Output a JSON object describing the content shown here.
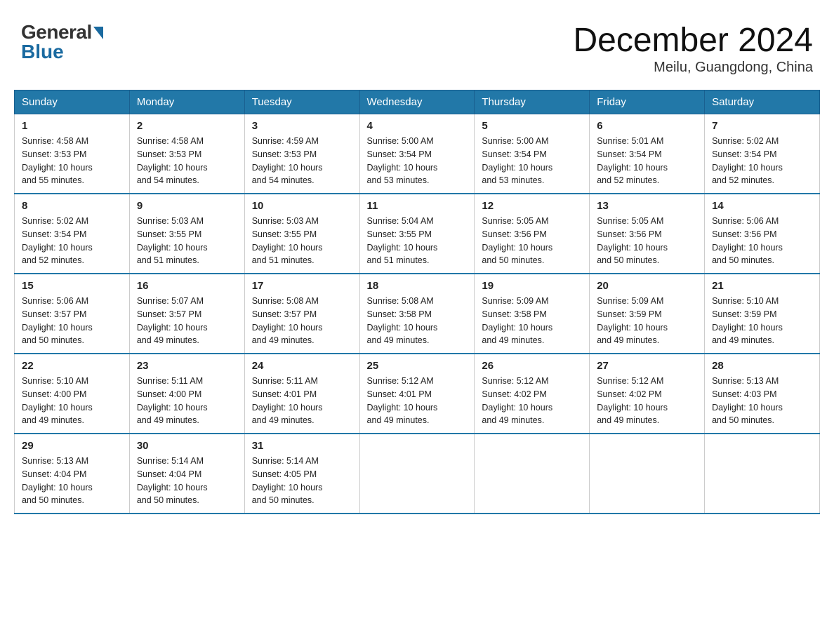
{
  "header": {
    "logo_general": "General",
    "logo_blue": "Blue",
    "month_title": "December 2024",
    "location": "Meilu, Guangdong, China"
  },
  "weekdays": [
    "Sunday",
    "Monday",
    "Tuesday",
    "Wednesday",
    "Thursday",
    "Friday",
    "Saturday"
  ],
  "weeks": [
    [
      {
        "day": "1",
        "sunrise": "4:58 AM",
        "sunset": "3:53 PM",
        "daylight": "10 hours and 55 minutes."
      },
      {
        "day": "2",
        "sunrise": "4:58 AM",
        "sunset": "3:53 PM",
        "daylight": "10 hours and 54 minutes."
      },
      {
        "day": "3",
        "sunrise": "4:59 AM",
        "sunset": "3:53 PM",
        "daylight": "10 hours and 54 minutes."
      },
      {
        "day": "4",
        "sunrise": "5:00 AM",
        "sunset": "3:54 PM",
        "daylight": "10 hours and 53 minutes."
      },
      {
        "day": "5",
        "sunrise": "5:00 AM",
        "sunset": "3:54 PM",
        "daylight": "10 hours and 53 minutes."
      },
      {
        "day": "6",
        "sunrise": "5:01 AM",
        "sunset": "3:54 PM",
        "daylight": "10 hours and 52 minutes."
      },
      {
        "day": "7",
        "sunrise": "5:02 AM",
        "sunset": "3:54 PM",
        "daylight": "10 hours and 52 minutes."
      }
    ],
    [
      {
        "day": "8",
        "sunrise": "5:02 AM",
        "sunset": "3:54 PM",
        "daylight": "10 hours and 52 minutes."
      },
      {
        "day": "9",
        "sunrise": "5:03 AM",
        "sunset": "3:55 PM",
        "daylight": "10 hours and 51 minutes."
      },
      {
        "day": "10",
        "sunrise": "5:03 AM",
        "sunset": "3:55 PM",
        "daylight": "10 hours and 51 minutes."
      },
      {
        "day": "11",
        "sunrise": "5:04 AM",
        "sunset": "3:55 PM",
        "daylight": "10 hours and 51 minutes."
      },
      {
        "day": "12",
        "sunrise": "5:05 AM",
        "sunset": "3:56 PM",
        "daylight": "10 hours and 50 minutes."
      },
      {
        "day": "13",
        "sunrise": "5:05 AM",
        "sunset": "3:56 PM",
        "daylight": "10 hours and 50 minutes."
      },
      {
        "day": "14",
        "sunrise": "5:06 AM",
        "sunset": "3:56 PM",
        "daylight": "10 hours and 50 minutes."
      }
    ],
    [
      {
        "day": "15",
        "sunrise": "5:06 AM",
        "sunset": "3:57 PM",
        "daylight": "10 hours and 50 minutes."
      },
      {
        "day": "16",
        "sunrise": "5:07 AM",
        "sunset": "3:57 PM",
        "daylight": "10 hours and 49 minutes."
      },
      {
        "day": "17",
        "sunrise": "5:08 AM",
        "sunset": "3:57 PM",
        "daylight": "10 hours and 49 minutes."
      },
      {
        "day": "18",
        "sunrise": "5:08 AM",
        "sunset": "3:58 PM",
        "daylight": "10 hours and 49 minutes."
      },
      {
        "day": "19",
        "sunrise": "5:09 AM",
        "sunset": "3:58 PM",
        "daylight": "10 hours and 49 minutes."
      },
      {
        "day": "20",
        "sunrise": "5:09 AM",
        "sunset": "3:59 PM",
        "daylight": "10 hours and 49 minutes."
      },
      {
        "day": "21",
        "sunrise": "5:10 AM",
        "sunset": "3:59 PM",
        "daylight": "10 hours and 49 minutes."
      }
    ],
    [
      {
        "day": "22",
        "sunrise": "5:10 AM",
        "sunset": "4:00 PM",
        "daylight": "10 hours and 49 minutes."
      },
      {
        "day": "23",
        "sunrise": "5:11 AM",
        "sunset": "4:00 PM",
        "daylight": "10 hours and 49 minutes."
      },
      {
        "day": "24",
        "sunrise": "5:11 AM",
        "sunset": "4:01 PM",
        "daylight": "10 hours and 49 minutes."
      },
      {
        "day": "25",
        "sunrise": "5:12 AM",
        "sunset": "4:01 PM",
        "daylight": "10 hours and 49 minutes."
      },
      {
        "day": "26",
        "sunrise": "5:12 AM",
        "sunset": "4:02 PM",
        "daylight": "10 hours and 49 minutes."
      },
      {
        "day": "27",
        "sunrise": "5:12 AM",
        "sunset": "4:02 PM",
        "daylight": "10 hours and 49 minutes."
      },
      {
        "day": "28",
        "sunrise": "5:13 AM",
        "sunset": "4:03 PM",
        "daylight": "10 hours and 50 minutes."
      }
    ],
    [
      {
        "day": "29",
        "sunrise": "5:13 AM",
        "sunset": "4:04 PM",
        "daylight": "10 hours and 50 minutes."
      },
      {
        "day": "30",
        "sunrise": "5:14 AM",
        "sunset": "4:04 PM",
        "daylight": "10 hours and 50 minutes."
      },
      {
        "day": "31",
        "sunrise": "5:14 AM",
        "sunset": "4:05 PM",
        "daylight": "10 hours and 50 minutes."
      },
      null,
      null,
      null,
      null
    ]
  ],
  "labels": {
    "sunrise": "Sunrise:",
    "sunset": "Sunset:",
    "daylight": "Daylight:"
  }
}
